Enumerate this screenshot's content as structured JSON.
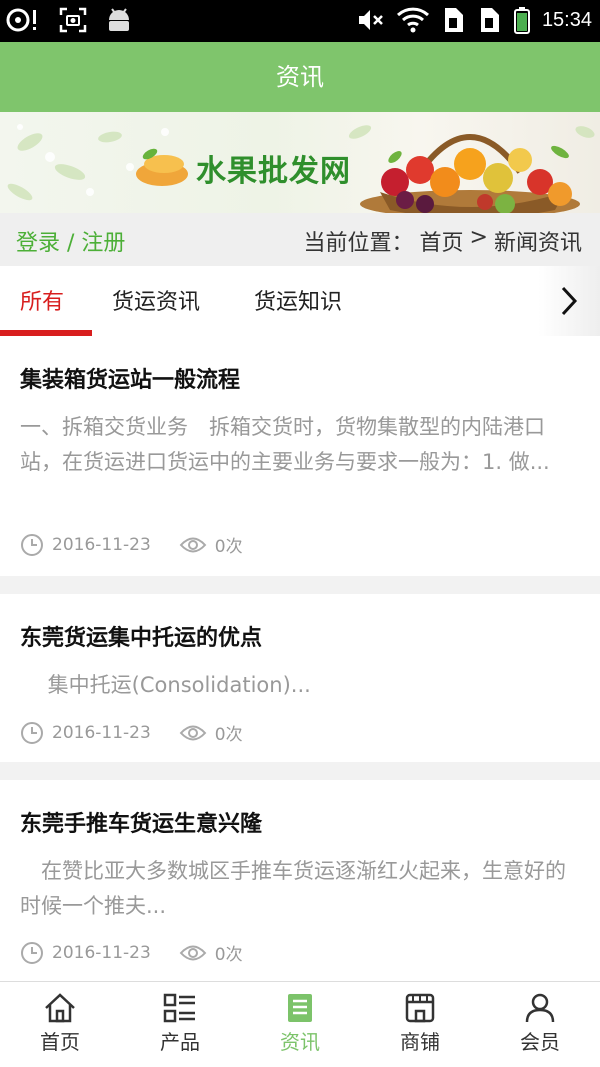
{
  "status_bar": {
    "time": "15:34",
    "icons_left": [
      "alert-icon",
      "screenshot-icon",
      "android-icon"
    ],
    "icons_right": [
      "mute-icon",
      "wifi-icon",
      "sim1-icon",
      "sim2-icon",
      "battery-icon"
    ]
  },
  "header": {
    "title": "资讯"
  },
  "banner": {
    "logo_text": "水果批发网"
  },
  "breadcrumb": {
    "login_register": "登录 / 注册",
    "location_label": "当前位置：",
    "home": "首页",
    "separator": ">",
    "current": "新闻资讯"
  },
  "tabs": [
    {
      "label": "所有",
      "active": true
    },
    {
      "label": "货运资讯",
      "active": false
    },
    {
      "label": "货运知识",
      "active": false
    }
  ],
  "articles": [
    {
      "title": "集装箱货运站一般流程",
      "summary": "一、拆箱交货业务　拆箱交货时，货物集散型的内陆港口站，在货运进口货运中的主要业务与要求一般为：1. 做...",
      "date": "2016-11-23",
      "views": "0次"
    },
    {
      "title": "东莞货运集中托运的优点",
      "summary": "　 集中托运(Consolidation)...",
      "date": "2016-11-23",
      "views": "0次"
    },
    {
      "title": "东莞手推车货运生意兴隆",
      "summary": "　在赞比亚大多数城区手推车货运逐渐红火起来，生意好的时候一个推夫...",
      "date": "2016-11-23",
      "views": "0次"
    }
  ],
  "bottom_nav": [
    {
      "label": "首页",
      "icon": "home-icon",
      "active": false
    },
    {
      "label": "产品",
      "icon": "product-list-icon",
      "active": false
    },
    {
      "label": "资讯",
      "icon": "news-icon",
      "active": true
    },
    {
      "label": "商铺",
      "icon": "shop-icon",
      "active": false
    },
    {
      "label": "会员",
      "icon": "member-icon",
      "active": false
    }
  ],
  "colors": {
    "header_green": "#7fc56c",
    "active_red": "#d81e1e",
    "login_green": "#4caf37",
    "nav_active": "#7cc36a"
  }
}
